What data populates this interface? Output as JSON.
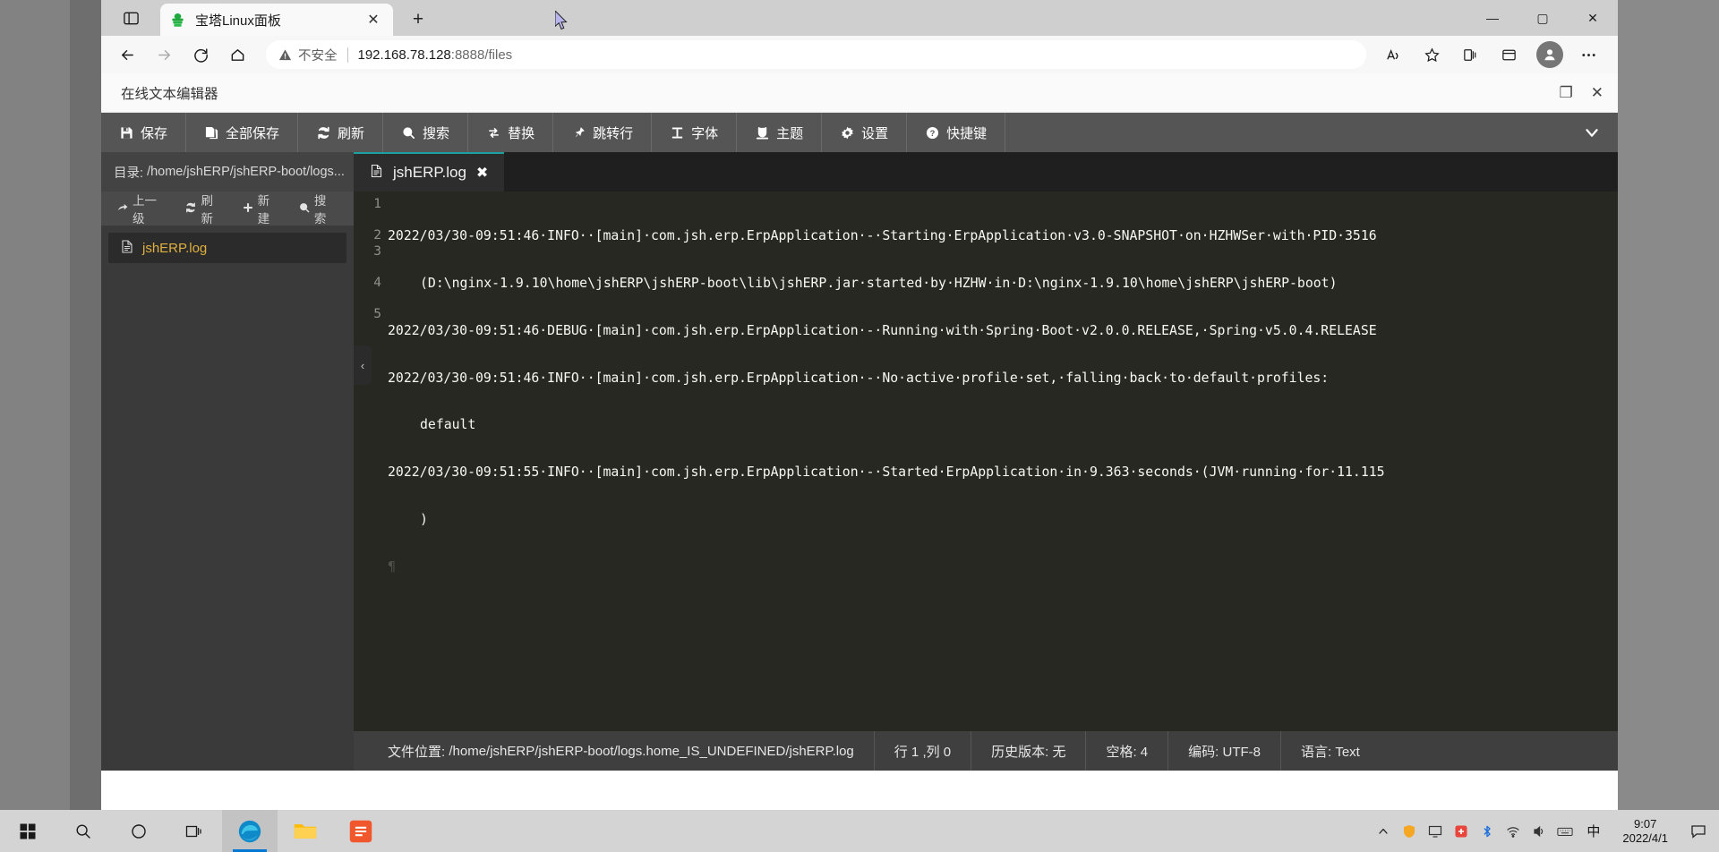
{
  "browser": {
    "tab": {
      "title": "宝塔Linux面板",
      "favicon": "bt-panda-icon",
      "close_label": "✕"
    },
    "newtab_label": "+",
    "window_controls": {
      "minimize": "—",
      "maximize": "▢",
      "close": "✕"
    },
    "nav": {
      "back": "back-arrow-icon",
      "forward": "forward-arrow-icon",
      "refresh": "refresh-icon",
      "home": "home-icon"
    },
    "omnibox": {
      "security_label": "不安全",
      "url_host": "192.168.78.128",
      "url_path": ":8888/files",
      "read_aloud": "A↗",
      "add_favorite": "☆",
      "collections": "collections-icon",
      "favorites": "favorites-icon",
      "profile": "profile-avatar",
      "settings_more": "⋯"
    }
  },
  "panel": {
    "title": "在线文本编辑器",
    "restore_label": "❐",
    "close_label": "✕"
  },
  "toolbar": {
    "items": [
      {
        "icon": "save-icon",
        "label": "保存"
      },
      {
        "icon": "save-all-icon",
        "label": "全部保存"
      },
      {
        "icon": "refresh-icon",
        "label": "刷新"
      },
      {
        "icon": "search-icon",
        "label": "搜索"
      },
      {
        "icon": "replace-icon",
        "label": "替换"
      },
      {
        "icon": "goto-line-icon",
        "label": "跳转行"
      },
      {
        "icon": "font-icon",
        "label": "字体"
      },
      {
        "icon": "theme-icon",
        "label": "主题"
      },
      {
        "icon": "settings-icon",
        "label": "设置"
      },
      {
        "icon": "shortcut-icon",
        "label": "快捷键"
      }
    ],
    "collapse_label": "⌄"
  },
  "sidebar": {
    "dir_label": "目录:",
    "dir_path": "/home/jshERP/jshERP-boot/logs...",
    "tools": [
      {
        "icon": "up-level-icon",
        "label": "上一级"
      },
      {
        "icon": "refresh-icon",
        "label": "刷新"
      },
      {
        "icon": "plus-icon",
        "label": "新建"
      },
      {
        "icon": "search-icon",
        "label": "搜索"
      }
    ],
    "files": [
      {
        "icon": "file-icon",
        "name": "jshERP.log",
        "selected": true
      }
    ],
    "collapse_handle": "‹"
  },
  "editor": {
    "tab": {
      "icon": "file-icon",
      "label": "jshERP.log",
      "close": "✖"
    },
    "line_numbers": [
      "1",
      "2",
      "3",
      "4",
      "5"
    ],
    "lines": [
      {
        "num": "1",
        "text": "2022/03/30-09:51:46·INFO··[main]·com.jsh.erp.ErpApplication·-·Starting·ErpApplication·v3.0-SNAPSHOT·on·HZHWSer·with·PID·3516",
        "wrap": "(D:\\nginx-1.9.10\\home\\jshERP\\jshERP-boot\\lib\\jshERP.jar·started·by·HZHW·in·D:\\nginx-1.9.10\\home\\jshERP\\jshERP-boot)"
      },
      {
        "num": "2",
        "text": "2022/03/30-09:51:46·DEBUG·[main]·com.jsh.erp.ErpApplication·-·Running·with·Spring·Boot·v2.0.0.RELEASE,·Spring·v5.0.4.RELEASE",
        "wrap": ""
      },
      {
        "num": "3",
        "text": "2022/03/30-09:51:46·INFO··[main]·com.jsh.erp.ErpApplication·-·No·active·profile·set,·falling·back·to·default·profiles:",
        "wrap": "default"
      },
      {
        "num": "4",
        "text": "2022/03/30-09:51:55·INFO··[main]·com.jsh.erp.ErpApplication·-·Started·ErpApplication·in·9.363·seconds·(JVM·running·for·11.115",
        "wrap": ")"
      },
      {
        "num": "5",
        "text": "",
        "wrap": ""
      }
    ]
  },
  "statusbar": {
    "file_label": "文件位置:",
    "file_path": "/home/jshERP/jshERP-boot/logs.home_IS_UNDEFINED/jshERP.log",
    "cursor": "行 1 ,列 0",
    "history": "历史版本: 无",
    "spaces": "空格: 4",
    "encoding": "编码: UTF-8",
    "language": "语言: Text"
  },
  "taskbar": {
    "start": "windows-start-icon",
    "search": "search-icon",
    "cortana": "cortana-circle-icon",
    "taskview": "task-view-icon",
    "apps": [
      {
        "icon": "edge-browser-icon",
        "active": true
      },
      {
        "icon": "file-explorer-icon",
        "active": false
      },
      {
        "icon": "bt-terminal-icon",
        "active": false
      }
    ],
    "tray": [
      "tray-arrow-icon",
      "tray-shield-icon",
      "tray-monitor-icon",
      "tray-red-icon",
      "bluetooth-icon",
      "network-icon",
      "volume-icon",
      "keyboard-icon"
    ],
    "ime": "中",
    "clock_time": "9:07",
    "clock_date": "2022/4/1",
    "notifications": "notification-icon"
  },
  "colors": {
    "toolbar_bg": "#555555",
    "sidebar_bg": "#3a3a3a",
    "editor_bg": "#272822",
    "accent_orange": "#e0b040",
    "accent_teal": "#1aa0a0",
    "taskbar_accent": "#0078d4"
  }
}
